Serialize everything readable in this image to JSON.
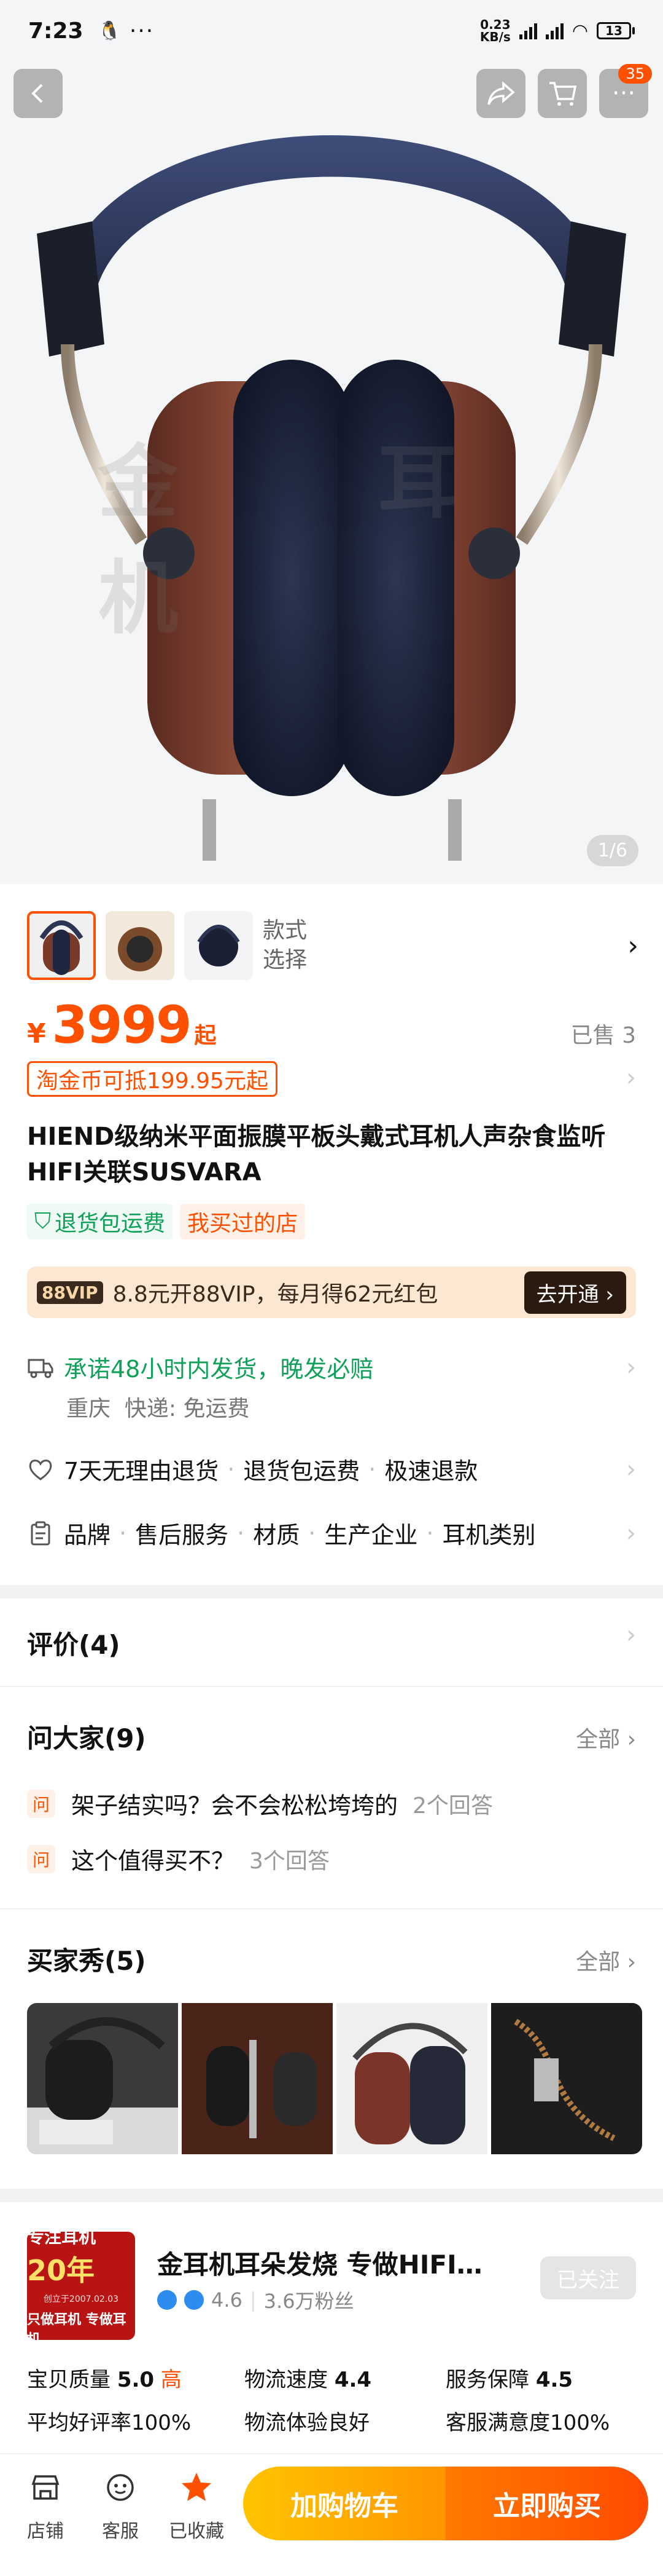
{
  "status": {
    "time": "7:23",
    "net_speed": "0.23",
    "net_unit": "KB/s",
    "battery": "13",
    "dots": "···"
  },
  "nav": {
    "back_icon": "chevron-left-icon",
    "share_icon": "share-icon",
    "cart_icon": "cart-icon",
    "cart_badge": "35"
  },
  "gallery": {
    "counter": "1/6",
    "watermark": "金 耳 机"
  },
  "sku": {
    "label_line1": "款式",
    "label_line2": "选择"
  },
  "price": {
    "currency": "¥",
    "amount": "3999",
    "suffix": "起",
    "sold": "已售 3",
    "coin_offer": "淘金币可抵199.95元起"
  },
  "product": {
    "title": "HIEND级纳米平面振膜平板头戴式耳机人声杂食监听HIFI关联SUSVARA",
    "tags": [
      "退货包运费",
      "我买过的店"
    ]
  },
  "vip": {
    "badge": "88VIP",
    "text": "8.8元开88VIP，每月得62元红包",
    "button": "去开通"
  },
  "shipping": {
    "promise": "承诺48小时内发货，晚发必赔",
    "origin": "重庆",
    "method": "快递: 免运费"
  },
  "guarantees": [
    "7天无理由退货",
    "退货包运费",
    "极速退款"
  ],
  "params": [
    "品牌",
    "售后服务",
    "材质",
    "生产企业",
    "耳机类别"
  ],
  "reviews": {
    "title": "评价(4)"
  },
  "qa": {
    "title": "问大家(9)",
    "all": "全部",
    "badge": "问",
    "items": [
      {
        "q": "架子结实吗？会不会松松垮垮的",
        "count": "2个回答"
      },
      {
        "q": "这个值得买不？",
        "count": "3个回答"
      }
    ]
  },
  "buyer_show": {
    "title": "买家秀(5)",
    "all": "全部"
  },
  "shop": {
    "logo_line1": "专注耳机",
    "logo_years": "20年",
    "logo_line2": "创立于2007.02.03",
    "logo_line3": "只做耳机 专做耳机",
    "name": "金耳机耳朵发烧 专做HIFI…",
    "rating": "4.6",
    "fans": "3.6万粉丝",
    "follow": "已关注"
  },
  "scores": [
    {
      "label": "宝贝质量",
      "value": "5.0",
      "level": "高",
      "sub": "平均好评率100%"
    },
    {
      "label": "物流速度",
      "value": "4.4",
      "level": "",
      "sub": "物流体验良好"
    },
    {
      "label": "服务保障",
      "value": "4.5",
      "level": "",
      "sub": "客服满意度100%"
    }
  ],
  "bottom": {
    "shop": "店铺",
    "service": "客服",
    "favorite": "已收藏",
    "add_cart": "加购物车",
    "buy_now": "立即购买"
  },
  "colors": {
    "accent": "#ff5000",
    "green": "#11a05a",
    "vip_bg": "#fbe7d2"
  }
}
